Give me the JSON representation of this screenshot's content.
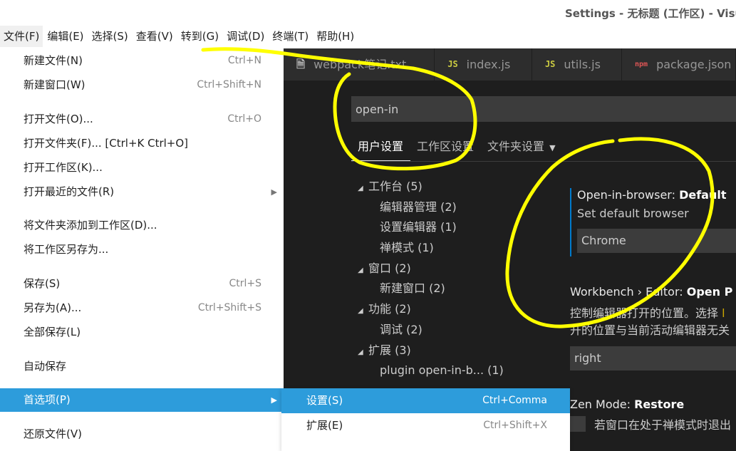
{
  "window": {
    "title": "Settings - 无标题 (工作区) - Visual S"
  },
  "menubar": {
    "items": [
      {
        "label": "文件(F)"
      },
      {
        "label": "编辑(E)"
      },
      {
        "label": "选择(S)"
      },
      {
        "label": "查看(V)"
      },
      {
        "label": "转到(G)"
      },
      {
        "label": "调试(D)"
      },
      {
        "label": "终端(T)"
      },
      {
        "label": "帮助(H)"
      }
    ]
  },
  "file_menu": {
    "items": [
      {
        "label": "新建文件(N)",
        "shortcut": "Ctrl+N"
      },
      {
        "label": "新建窗口(W)",
        "shortcut": "Ctrl+Shift+N"
      },
      {
        "label": "打开文件(O)...",
        "shortcut": "Ctrl+O"
      },
      {
        "label": "打开文件夹(F)... [Ctrl+K Ctrl+O]",
        "shortcut": ""
      },
      {
        "label": "打开工作区(K)...",
        "shortcut": ""
      },
      {
        "label": "打开最近的文件(R)",
        "shortcut": ""
      },
      {
        "label": "将文件夹添加到工作区(D)...",
        "shortcut": ""
      },
      {
        "label": "将工作区另存为...",
        "shortcut": ""
      },
      {
        "label": "保存(S)",
        "shortcut": "Ctrl+S"
      },
      {
        "label": "另存为(A)...",
        "shortcut": "Ctrl+Shift+S"
      },
      {
        "label": "全部保存(L)",
        "shortcut": ""
      },
      {
        "label": "自动保存",
        "shortcut": ""
      },
      {
        "label": "首选项(P)",
        "shortcut": ""
      },
      {
        "label": "还原文件(V)",
        "shortcut": ""
      }
    ]
  },
  "submenu": {
    "items": [
      {
        "label": "设置(S)",
        "shortcut": "Ctrl+Comma"
      },
      {
        "label": "扩展(E)",
        "shortcut": "Ctrl+Shift+X"
      }
    ]
  },
  "editor_tabs": [
    {
      "label": "webpack笔记.txt",
      "icon": "file-icon"
    },
    {
      "label": "index.js",
      "icon": "js-icon",
      "icon_text": "JS"
    },
    {
      "label": "utils.js",
      "icon": "js-icon",
      "icon_text": "JS"
    },
    {
      "label": "package.json",
      "icon": "npm-icon",
      "icon_text": "npm"
    }
  ],
  "settings": {
    "search_value": "open-in",
    "scope_tabs": [
      "用户设置",
      "工作区设置",
      "文件夹设置"
    ],
    "toc": [
      {
        "label": "工作台 (5)",
        "level": 1
      },
      {
        "label": "编辑器管理 (2)",
        "level": 2
      },
      {
        "label": "设置编辑器 (1)",
        "level": 2
      },
      {
        "label": "禅模式 (1)",
        "level": 2
      },
      {
        "label": "窗口 (2)",
        "level": 1
      },
      {
        "label": "新建窗口 (2)",
        "level": 2
      },
      {
        "label": "功能 (2)",
        "level": 1
      },
      {
        "label": "调试 (2)",
        "level": 2
      },
      {
        "label": "扩展 (3)",
        "level": 1
      },
      {
        "label": "plugin open-in-b... (1)",
        "level": 2
      }
    ],
    "setting1": {
      "category": "Open-in-browser: ",
      "name": "Default",
      "description": "Set default browser",
      "value": "Chrome"
    },
    "setting2": {
      "category": "Workbench › Editor: ",
      "name": "Open P",
      "description_prefix": "控制编辑器打开的位置。选择 ",
      "description_value": "l",
      "description_line2": "开的位置与当前活动编辑器无关",
      "value": "right"
    },
    "setting3": {
      "category": "Zen Mode: ",
      "name": "Restore",
      "description": "若窗口在处于禅模式时退出"
    }
  },
  "colors": {
    "highlight": "#2d9cdb",
    "annotation": "#ffff00",
    "editor_bg": "#1e1e1e"
  }
}
